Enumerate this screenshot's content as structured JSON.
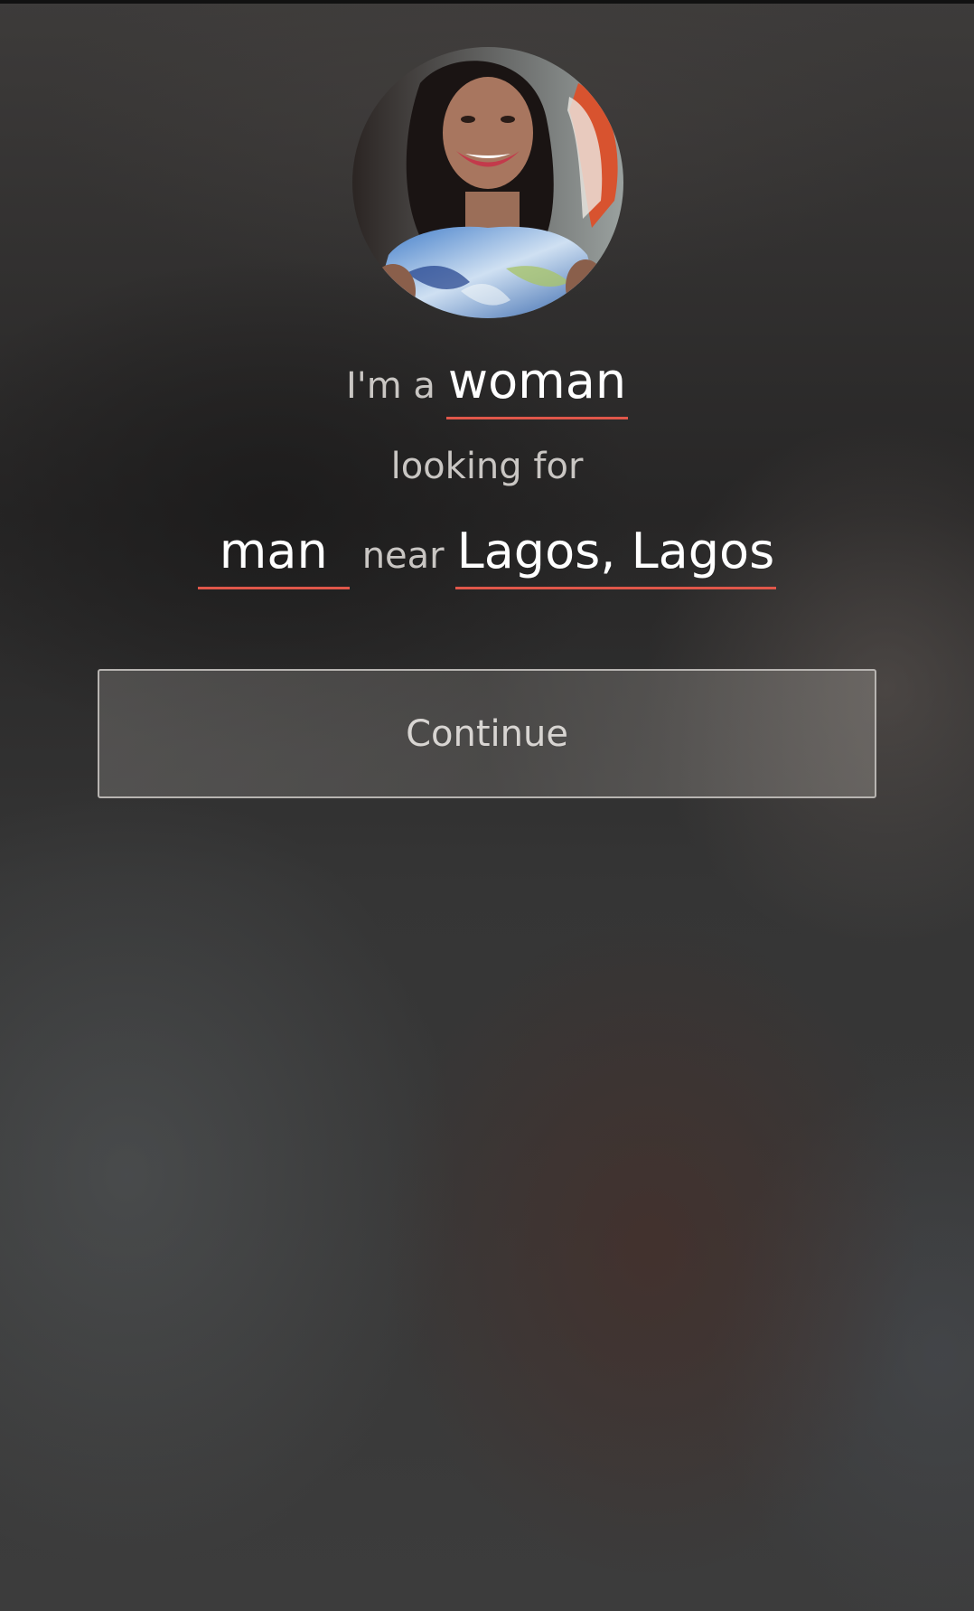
{
  "profile": {
    "intro_text": "I'm a",
    "gender": "woman",
    "looking_for_text": "looking for",
    "seeking": "man",
    "near_text": "near",
    "location": "Lagos, Lagos"
  },
  "actions": {
    "continue_label": "Continue"
  },
  "colors": {
    "accent_underline": "#e0574a",
    "text_primary": "#ffffff",
    "text_muted": "#c9c6c3"
  },
  "icons": {
    "avatar": "profile-photo"
  }
}
